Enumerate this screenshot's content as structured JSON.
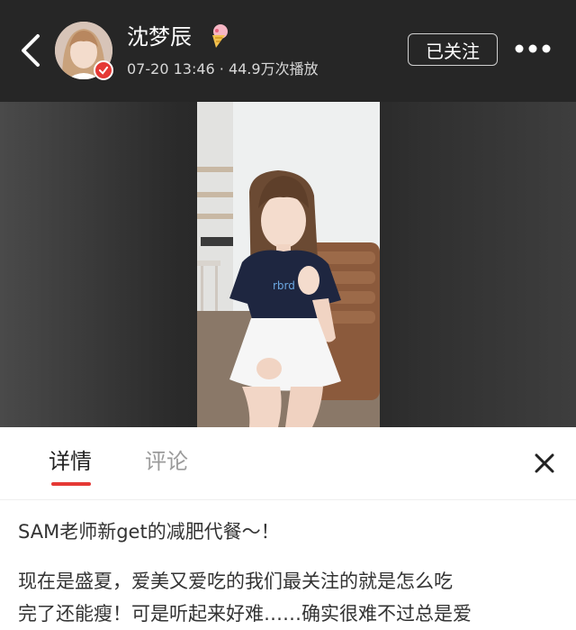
{
  "header": {
    "user_name": "沈梦辰",
    "meta": "07-20 13:46 · 44.9万次播放",
    "follow_label": "已关注"
  },
  "tabs": [
    {
      "label": "详情"
    },
    {
      "label": "评论"
    }
  ],
  "content": {
    "title": "SAM老师新get的减肥代餐～！",
    "body_lines": [
      "现在是盛夏，爱美又爱吃的我们最关注的就是怎么吃",
      "完了还能瘦！可是听起来好难……确实很难不过总是爱"
    ]
  },
  "video": {
    "shirt_text": "rbrd"
  },
  "colors": {
    "header_bg": "#262626",
    "accent": "#e53935",
    "text_primary": "#333333",
    "text_muted": "#9b9b9b"
  },
  "icons": [
    "back-arrow-icon",
    "verified-icon",
    "ice-cream-badge-icon",
    "more-dots-icon",
    "close-icon"
  ]
}
